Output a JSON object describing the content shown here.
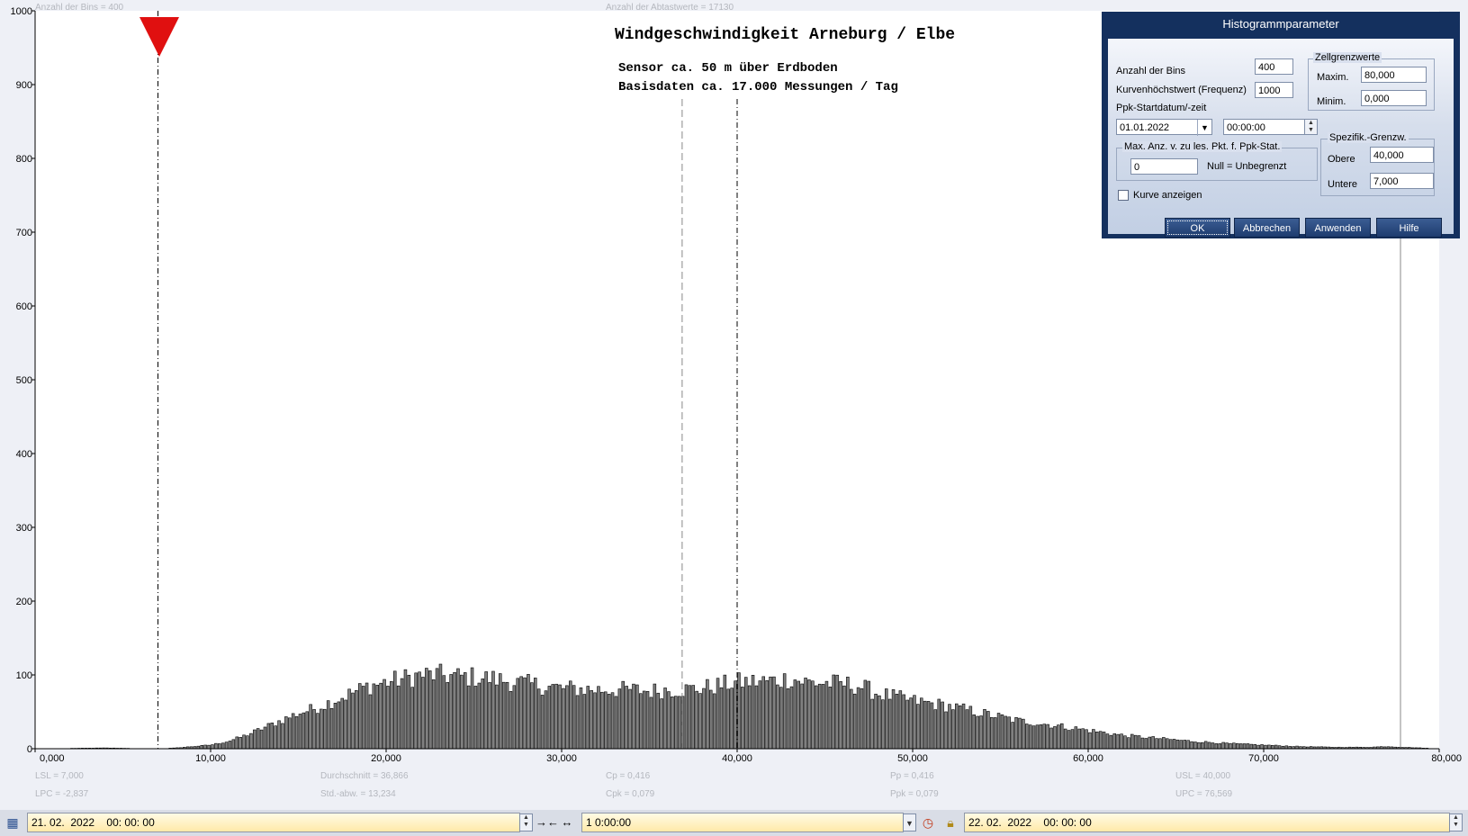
{
  "chart": {
    "title": "Windgeschwindigkeit  Arneburg / Elbe",
    "subtitle1": "Sensor ca. 50 m über Erdboden",
    "subtitle2": "Basisdaten ca. 17.000 Messungen / Tag",
    "header_bins": "Anzahl der Bins =   400",
    "header_samples": "Anzahl der Abtastwerte = 17130",
    "y_ticks": [
      "1000",
      "900",
      "800",
      "700",
      "600",
      "500",
      "400",
      "300",
      "200",
      "100",
      "0"
    ],
    "x_ticks": [
      "0,000",
      "10,000",
      "20,000",
      "30,000",
      "40,000",
      "50,000",
      "60,000",
      "70,000",
      "80,000"
    ],
    "stats": {
      "lsl": "LSL = 7,000",
      "lpc": "LPC = -2,837",
      "mean": "Durchschnitt  = 36,866",
      "std": "Std.-abw.  = 13,234",
      "cp": "Cp  = 0,416",
      "cpk": "Cpk = 0,079",
      "pp": "Pp  = 0,416",
      "ppk": "Ppk = 0,079",
      "usl": "USL = 40,000",
      "upc": "UPC = 76,569"
    },
    "colors": {
      "bar_fill": "#808080",
      "marker": "#e01010"
    }
  },
  "chart_data": {
    "type": "bar",
    "title": "Windgeschwindigkeit  Arneburg / Elbe",
    "xlabel": "",
    "ylabel": "",
    "xlim": [
      0,
      80
    ],
    "ylim": [
      0,
      1000
    ],
    "bin_width": 0.2,
    "bins": 400,
    "lsl": 7.0,
    "usl": 40.0,
    "mean": 36.866,
    "envelope_x": [
      0,
      4,
      7,
      8,
      10,
      11,
      12,
      13,
      14,
      15,
      16,
      17,
      18,
      19,
      20,
      21,
      22,
      23,
      24,
      25,
      26,
      28,
      30,
      32,
      34,
      35,
      36,
      37,
      38,
      40,
      42,
      43,
      44,
      46,
      47,
      48,
      50,
      52,
      54,
      56,
      58,
      60,
      62,
      64,
      66,
      68,
      70,
      72,
      74,
      76,
      77,
      80
    ],
    "envelope_y": [
      0,
      1,
      0,
      1,
      5,
      10,
      18,
      28,
      38,
      48,
      55,
      65,
      75,
      85,
      90,
      95,
      100,
      100,
      98,
      97,
      95,
      88,
      82,
      80,
      80,
      78,
      80,
      80,
      82,
      90,
      92,
      95,
      90,
      88,
      85,
      75,
      65,
      58,
      48,
      38,
      32,
      25,
      18,
      14,
      10,
      7,
      5,
      3,
      2,
      2,
      3,
      0
    ]
  },
  "dialog": {
    "title": "Histogrammparameter",
    "bins_label": "Anzahl der Bins",
    "bins_value": "400",
    "peak_label": "Kurvenhöchstwert (Frequenz)",
    "peak_value": "1000",
    "ppk_start_label": "Ppk-Startdatum/-zeit",
    "start_date": "01.01.2022",
    "start_time": "00:00:00",
    "cell_group": "Zellgrenzwerte",
    "max_label": "Maxim.",
    "max_value": "80,000",
    "min_label": "Minim.",
    "min_value": "0,000",
    "spec_group": "Spezifik.-Grenzw.",
    "upper_label": "Obere",
    "upper_value": "40,000",
    "lower_label": "Untere",
    "lower_value": "7,000",
    "maxcount_group": "Max. Anz. v. zu les. Pkt. f. Ppk-Stat.",
    "maxcount_value": "0",
    "maxcount_hint": "Null = Unbegrenzt",
    "show_curve_label": "Kurve anzeigen",
    "show_curve_checked": false,
    "ok": "OK",
    "cancel": "Abbrechen",
    "apply": "Anwenden",
    "help": "Hilfe"
  },
  "bottombar": {
    "start": "21. 02.  2022    00: 00: 00",
    "interval": "1 0:00:00",
    "end": "22. 02.  2022    00: 00: 00"
  }
}
